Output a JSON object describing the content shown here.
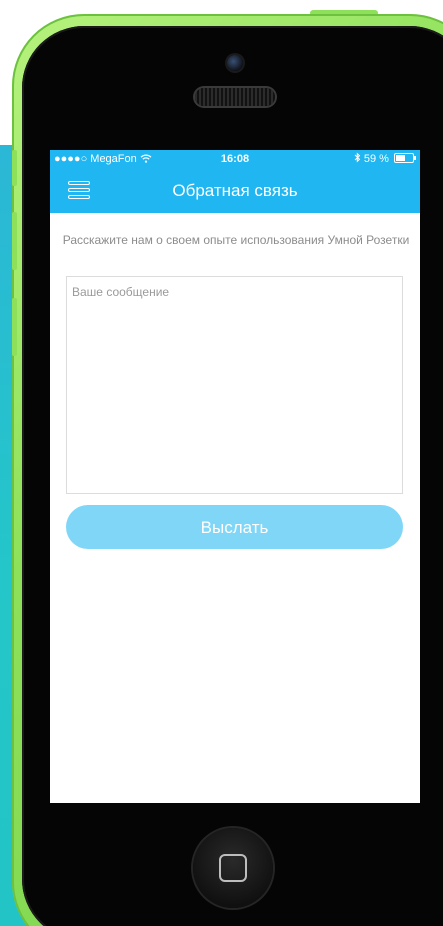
{
  "status_bar": {
    "carrier": "●●●●○ MegaFon",
    "wifi_icon": "wifi-icon",
    "time": "16:08",
    "bluetooth_icon": "bluetooth-icon",
    "battery_percent": "59 %",
    "battery_level": 0.59
  },
  "nav_bar": {
    "menu_icon": "hamburger-menu-icon",
    "title": "Обратная связь"
  },
  "feedback": {
    "prompt": "Расскажите нам о своем опыте использования Умной Розетки",
    "message_value": "",
    "message_placeholder": "Ваше сообщение",
    "send_label": "Выслать"
  },
  "colors": {
    "accent": "#1fb6f2",
    "button_disabled": "#7fd6f7",
    "device_shell": "#8ee05a",
    "backdrop": "#24c6c9"
  }
}
